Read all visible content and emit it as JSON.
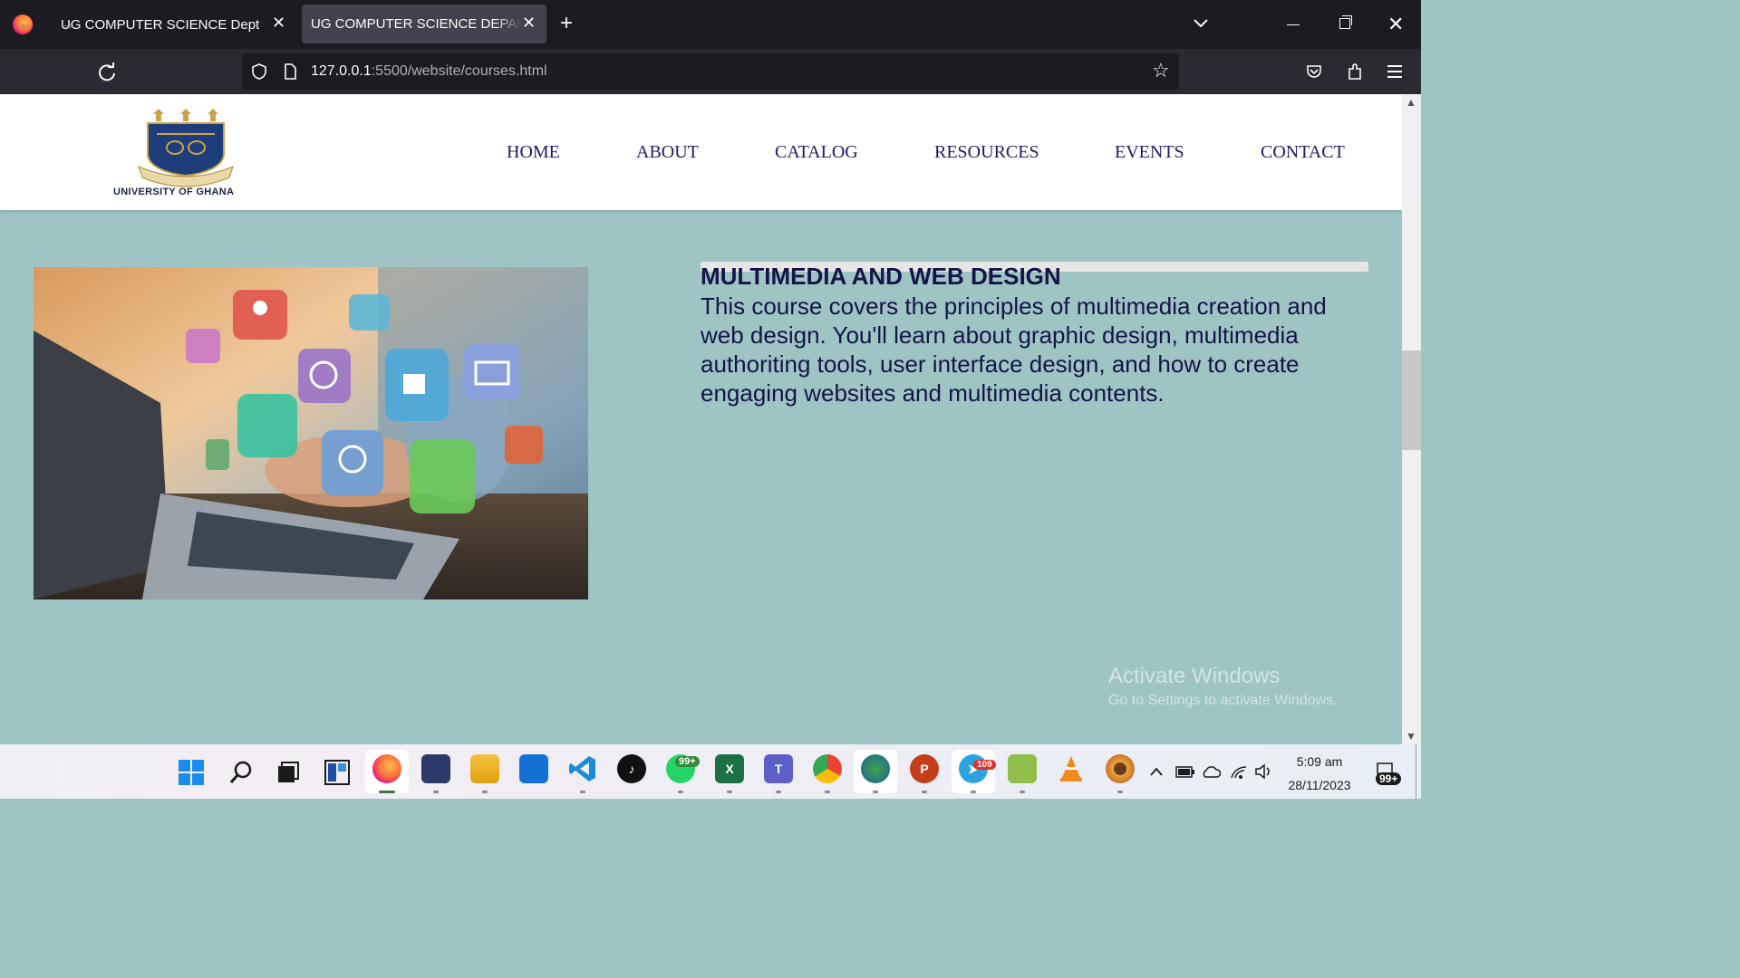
{
  "browser": {
    "tabs": [
      {
        "title": "UG COMPUTER SCIENCE Dept.",
        "active": false
      },
      {
        "title": "UG COMPUTER SCIENCE DEPARTMENT",
        "active": true
      }
    ],
    "url_host": "127.0.0.1",
    "url_path": ":5500/website/courses.html"
  },
  "site": {
    "logo_text": "UNIVERSITY OF GHANA",
    "logo_motto": "INTEGRI PROCEDAMUS",
    "nav": [
      "HOME",
      "ABOUT",
      "CATALOG",
      "RESOURCES",
      "EVENTS",
      "CONTACT"
    ]
  },
  "course": {
    "title": "MULTIMEDIA AND WEB DESIGN",
    "description": "This course covers the principles of multimedia creation and web design. You'll learn about graphic design, multimedia authoriting tools, user interface design, and how to create engaging websites and multimedia contents."
  },
  "watermark": {
    "line1": "Activate Windows",
    "line2": "Go to Settings to activate Windows."
  },
  "taskbar": {
    "whatsapp_badge": "99+",
    "telegram_badge": "109",
    "notification_badge": "99+",
    "time": "5:09 am",
    "date": "28/11/2023"
  },
  "colors": {
    "page_bg": "#9ec4c4",
    "nav_text": "#1b1b6b",
    "heading_text": "#141446"
  }
}
